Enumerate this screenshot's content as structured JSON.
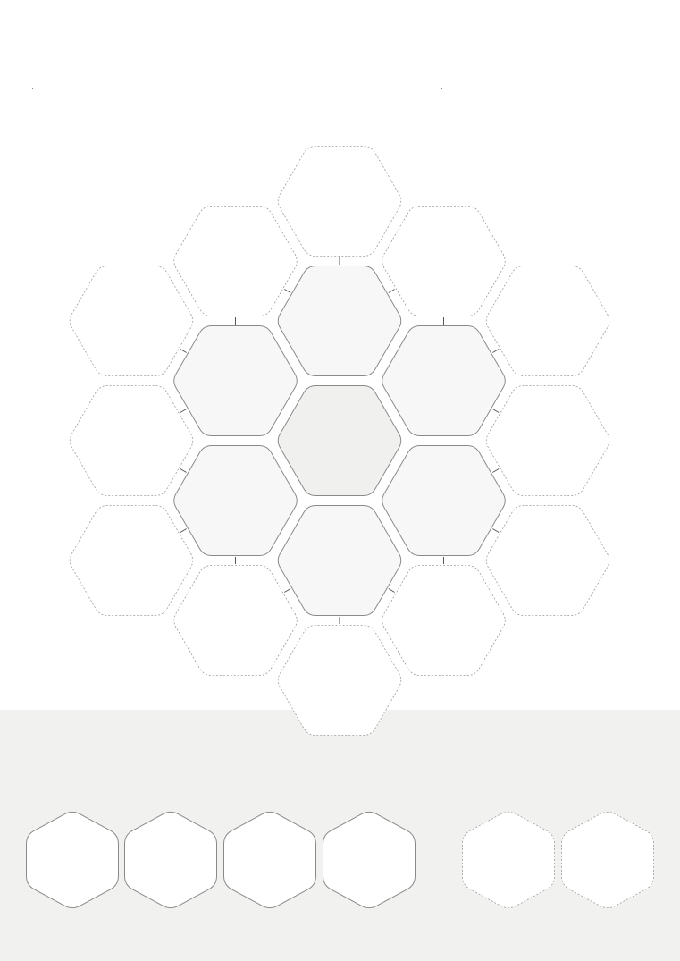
{
  "board": {
    "colors": {
      "page_background": "#ffffff",
      "tray_background": "#f1f1ef",
      "center_fill": "#f0f0ee",
      "inner_fill": "#f7f7f7",
      "outer_fill": "#ffffff",
      "solid_stroke": "#8a8a8a",
      "dashed_stroke": "#9c9c9c",
      "connector": "#555555"
    },
    "rings": [
      {
        "ring": 0,
        "state": "placed",
        "count": 1
      },
      {
        "ring": 1,
        "state": "placed",
        "count": 6
      },
      {
        "ring": 2,
        "state": "empty-slot",
        "count": 12
      }
    ]
  },
  "tray": {
    "tiles": [
      {
        "state": "available"
      },
      {
        "state": "available"
      },
      {
        "state": "available"
      },
      {
        "state": "available"
      },
      {
        "state": "ghost"
      },
      {
        "state": "ghost"
      }
    ]
  }
}
